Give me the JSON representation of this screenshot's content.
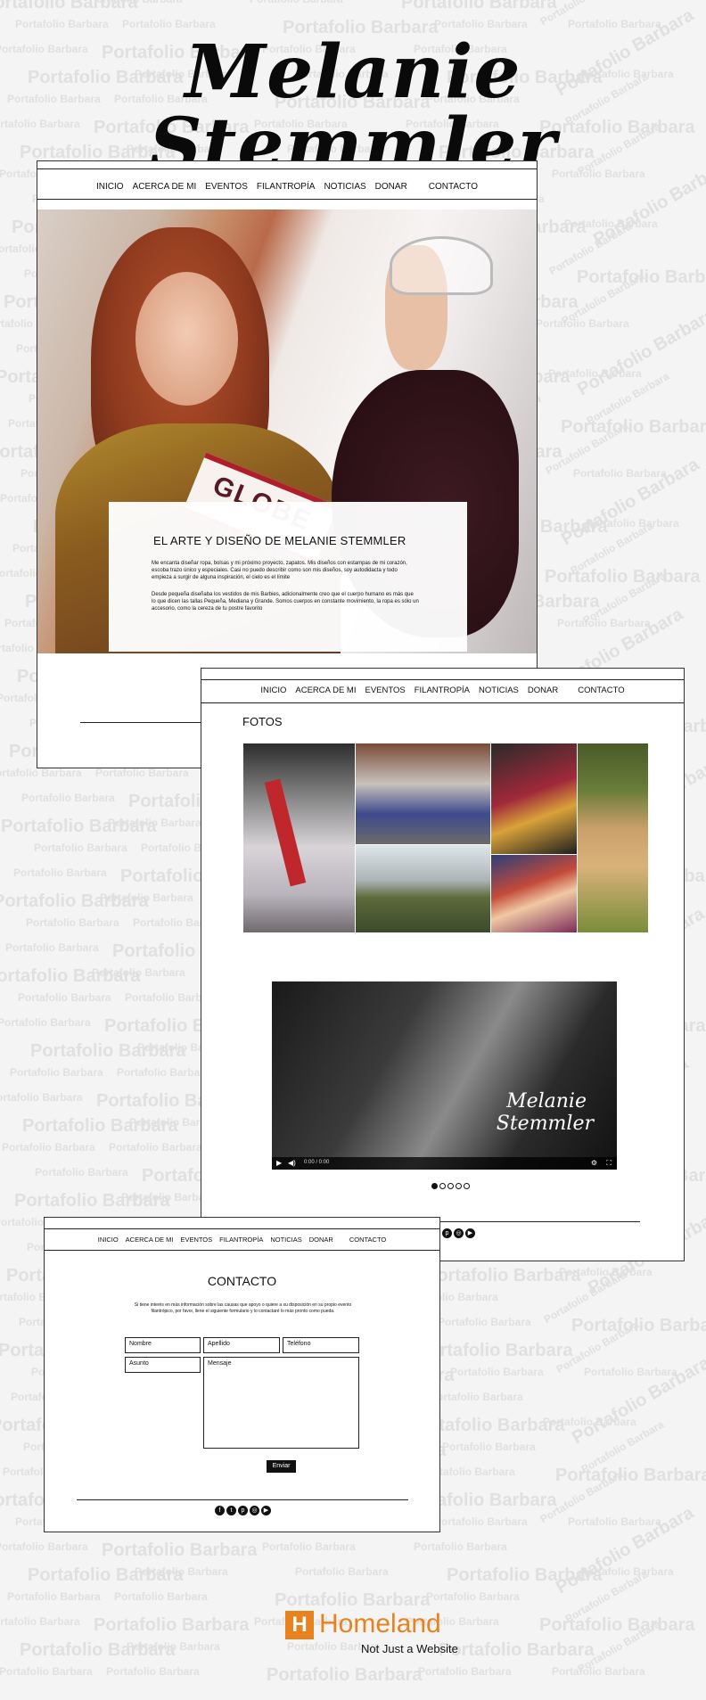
{
  "watermark_text": "Portafolio Barbara",
  "site_title": "Melanie Stemmler",
  "nav": [
    "INICIO",
    "ACERCA DE MI",
    "EVENTOS",
    "FILANTROPÍA",
    "NOTICIAS",
    "DONAR",
    "CONTACTO"
  ],
  "about": {
    "heading": "EL ARTE Y DISEÑO DE MELANIE STEMMLER",
    "para1": "Me encanta diseñar ropa, bolsas y mi próximo proyecto, zapatos. Mis diseños con estampas de mi corazón, escoba trazo único y especiales. Casi no puedo describir como son mis diseños, soy autodidacta y todo empieza a surgir de alguna inspiración, el cielo es el límite",
    "para2": "Desde pequeña diseñaba los vestidos de mis Barbies, adicionalmente creo que el cuerpo humano es más que lo que dicen las tallas Pequeña, Mediana y Grande. Somos cuerpos en constante movimiento, la ropa es sólo un accesorio, como la cereza de tu postre favorito"
  },
  "gallery": {
    "heading": "FOTOS"
  },
  "video": {
    "overlay_line1": "Melanie",
    "overlay_line2": "Stemmler",
    "time": "0:00 / 0:00"
  },
  "contact": {
    "heading": "CONTACTO",
    "intro": "Si tiene interés en más información sobre las causas que apoyo o quiere a su disposición en su propio evento filantrópico, por favor, llene el siguiente formulario y lo contactaré lo más pronto como pueda.",
    "fields": {
      "nombre": "Nombre",
      "apellido": "Apellido",
      "telefono": "Teléfono",
      "asunto": "Asunto",
      "mensaje": "Mensaje"
    },
    "submit": "Enviar"
  },
  "brand": {
    "logo_letter": "H",
    "name": "Homeland",
    "tagline": "Not Just a Website",
    "color": "#e8821e"
  },
  "social_icons": [
    "facebook-icon",
    "twitter-icon",
    "pinterest-icon",
    "instagram-icon",
    "youtube-icon"
  ],
  "social_glyphs": [
    "f",
    "t",
    "p",
    "◎",
    "▶"
  ]
}
